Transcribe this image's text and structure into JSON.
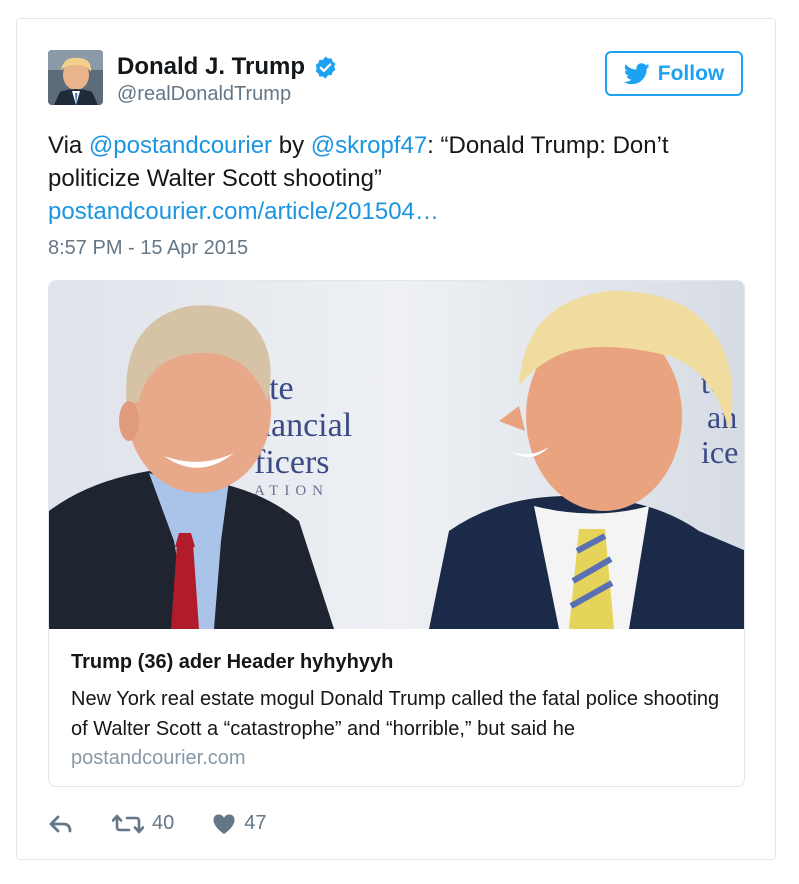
{
  "author": {
    "name": "Donald J. Trump",
    "handle": "@realDonaldTrump",
    "verified": true
  },
  "follow_button": {
    "label": "Follow",
    "icon": "twitter-bird-icon"
  },
  "tweet": {
    "prefix": "Via ",
    "mention1": "@postandcourier",
    "by": " by ",
    "mention2": "@skropf47",
    "quote": ": “Donald Trump: Don’t politicize Walter Scott shooting”",
    "url": "postandcourier.com/article/201504…",
    "timestamp": "8:57 PM - 15 Apr 2015"
  },
  "card": {
    "backdrop_lines": [
      "ate",
      "nancial",
      "ficers",
      "ATION"
    ],
    "backdrop_lines_right": [
      "te",
      "an",
      "ice"
    ],
    "title": "Trump (36) ader Header hyhyhyyh",
    "description": "New York real estate mogul Donald Trump called the fatal police shooting of Walter Scott a “catastrophe” and “horrible,” but said he",
    "domain": "postandcourier.com"
  },
  "actions": {
    "reply_icon": "reply-icon",
    "retweet_icon": "retweet-icon",
    "retweets": "40",
    "like_icon": "heart-icon",
    "likes": "47"
  },
  "colors": {
    "brand_blue": "#1da1f2",
    "link_blue": "#1b95e0",
    "muted": "#657786",
    "border": "#e1e8ed"
  }
}
